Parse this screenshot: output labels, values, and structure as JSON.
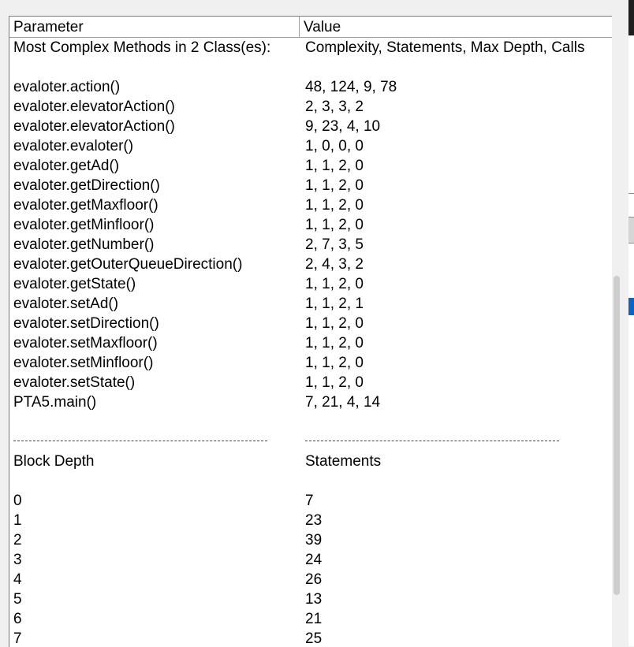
{
  "table": {
    "headers": {
      "parameter": "Parameter",
      "value": "Value"
    },
    "summary_row": {
      "parameter": "Most Complex Methods in 2 Class(es):",
      "value": "Complexity, Statements, Max Depth, Calls"
    },
    "methods": [
      {
        "name": "evaloter.action()",
        "metrics": "48, 124, 9, 78"
      },
      {
        "name": "evaloter.elevatorAction()",
        "metrics": "2, 3, 3, 2"
      },
      {
        "name": "evaloter.elevatorAction()",
        "metrics": "9, 23, 4, 10"
      },
      {
        "name": "evaloter.evaloter()",
        "metrics": "1, 0, 0, 0"
      },
      {
        "name": "evaloter.getAd()",
        "metrics": "1, 1, 2, 0"
      },
      {
        "name": "evaloter.getDirection()",
        "metrics": "1, 1, 2, 0"
      },
      {
        "name": "evaloter.getMaxfloor()",
        "metrics": "1, 1, 2, 0"
      },
      {
        "name": "evaloter.getMinfloor()",
        "metrics": "1, 1, 2, 0"
      },
      {
        "name": "evaloter.getNumber()",
        "metrics": "2, 7, 3, 5"
      },
      {
        "name": "evaloter.getOuterQueueDirection()",
        "metrics": "2, 4, 3, 2"
      },
      {
        "name": "evaloter.getState()",
        "metrics": "1, 1, 2, 0"
      },
      {
        "name": "evaloter.setAd()",
        "metrics": "1, 1, 2, 1"
      },
      {
        "name": "evaloter.setDirection()",
        "metrics": "1, 1, 2, 0"
      },
      {
        "name": "evaloter.setMaxfloor()",
        "metrics": "1, 1, 2, 0"
      },
      {
        "name": "evaloter.setMinfloor()",
        "metrics": "1, 1, 2, 0"
      },
      {
        "name": "evaloter.setState()",
        "metrics": "1, 1, 2, 0"
      },
      {
        "name": "PTA5.main()",
        "metrics": "7, 21, 4, 14"
      }
    ],
    "block_depth_header": {
      "parameter": "Block Depth",
      "value": "Statements"
    },
    "block_depths": [
      {
        "depth": "0",
        "statements": "7"
      },
      {
        "depth": "1",
        "statements": "23"
      },
      {
        "depth": "2",
        "statements": "39"
      },
      {
        "depth": "3",
        "statements": "24"
      },
      {
        "depth": "4",
        "statements": "26"
      },
      {
        "depth": "5",
        "statements": "13"
      },
      {
        "depth": "6",
        "statements": "21"
      },
      {
        "depth": "7",
        "statements": "25"
      }
    ]
  },
  "colors": {
    "background": "#ffffff",
    "window": "#f0f0f0",
    "gridline": "#a0a0a0",
    "selection_blue": "#0a64c8"
  }
}
